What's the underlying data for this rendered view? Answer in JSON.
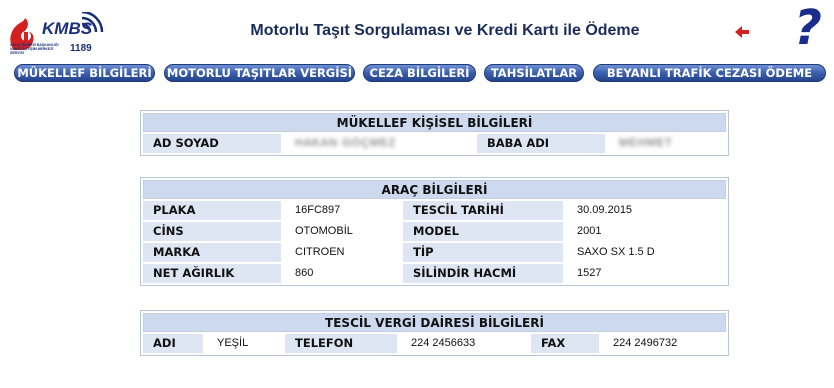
{
  "logo": {
    "brand": "KMBS",
    "number": "1189",
    "subtitle": "GELİR İDARESİ BAŞKANLIĞI VERGİ İLETİŞİM MERKEZİ SERVİSİ"
  },
  "header": {
    "title": "Motorlu Taşıt Sorgulaması ve Kredi Kartı ile Ödeme"
  },
  "icons": {
    "back": "left-arrow-icon",
    "help": "question-mark-icon",
    "help_glyph": "?"
  },
  "colors": {
    "nav_button": "#3b5fae",
    "title": "#1a2d5a",
    "header_bg": "#cdd9ee",
    "label_bg": "#dfe6f3",
    "back_arrow": "#d42020"
  },
  "nav": [
    "MÜKELLEF BİLGİLERİ",
    "MOTORLU TAŞITLAR VERGİSİ",
    "CEZA BİLGİLERİ",
    "TAHSİLATLAR",
    "BEYANLI TRAFİK CEZASI ÖDEME"
  ],
  "personal": {
    "header": "MÜKELLEF KİŞİSEL BİLGİLERİ",
    "name_label": "AD SOYAD",
    "name_value": "HAKAN GÖÇMEZ",
    "father_label": "BABA ADI",
    "father_value": "MEHMET"
  },
  "vehicle": {
    "header": "ARAÇ BİLGİLERİ",
    "rows": [
      {
        "l1": "PLAKA",
        "v1": "16FC897",
        "l2": "TESCİL TARİHİ",
        "v2": "30.09.2015"
      },
      {
        "l1": "CİNS",
        "v1": "OTOMOBİL",
        "l2": "MODEL",
        "v2": "2001"
      },
      {
        "l1": "MARKA",
        "v1": "CITROEN",
        "l2": "TİP",
        "v2": "SAXO SX 1.5 D"
      },
      {
        "l1": "NET AĞIRLIK",
        "v1": "860",
        "l2": "SİLİNDİR HACMİ",
        "v2": "1527"
      }
    ]
  },
  "tax_office": {
    "header": "TESCİL VERGİ DAİRESİ BİLGİLERİ",
    "name_label": "ADI",
    "name_value": "YEŞİL",
    "phone_label": "TELEFON",
    "phone_value": "224 2456633",
    "fax_label": "FAX",
    "fax_value": "224 2496732"
  }
}
